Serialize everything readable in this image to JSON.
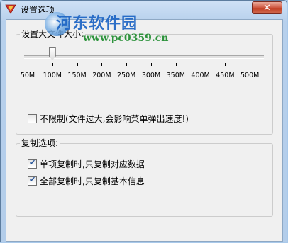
{
  "window": {
    "title": "设置选项",
    "close_glyph": "✕"
  },
  "watermark": {
    "site_name": "河东软件园",
    "site_url": "www.pc0359.cn"
  },
  "size_group": {
    "label": "设置大文件大小:",
    "slider": {
      "value": "100M",
      "ticks": [
        "50M",
        "100M",
        "150M",
        "200M",
        "250M",
        "300M",
        "350M",
        "400M",
        "450M",
        "500M"
      ]
    },
    "unlimited": {
      "label": "不限制(文件过大,会影响菜单弹出速度!)",
      "checked": false
    }
  },
  "copy_group": {
    "label": "复制选项:",
    "options": [
      {
        "label": "单项复制时,只复制对应数据",
        "checked": true
      },
      {
        "label": "全部复制时,只复制基本信息",
        "checked": true
      }
    ]
  },
  "colors": {
    "title_blue": "#1c64c4",
    "url_green": "#1a8a2a",
    "close_red": "#c24025"
  }
}
